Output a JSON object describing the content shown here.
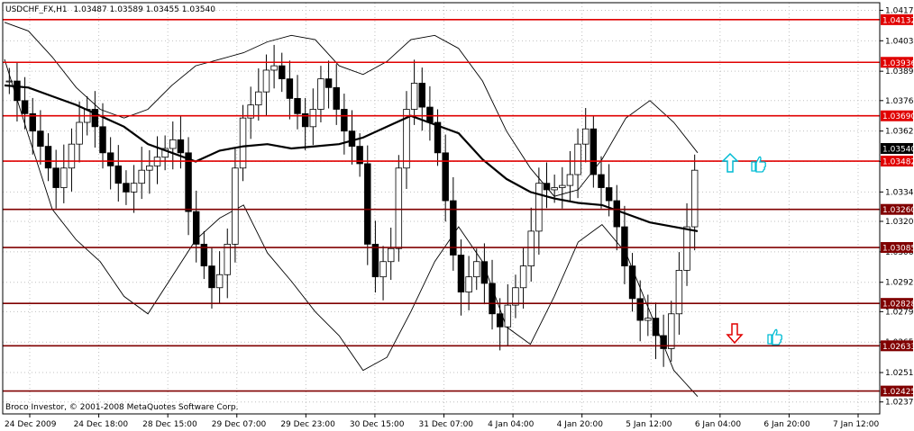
{
  "header": {
    "symbol": "USDCHF_FX,H1",
    "ohlc": "1.03487 1.03589 1.03455 1.03540"
  },
  "copyright": "Broco Investor, © 2001-2008 MetaQuotes Software Corp.",
  "colors": {
    "background": "#ffffff",
    "frame": "#000000",
    "grid": "#c0c0c0",
    "level_red": "#e00000",
    "level_dark": "#800000",
    "current_price_tag": "#000000",
    "arrow_up": "#00bcd4",
    "arrow_down": "#e00000",
    "hand_icon": "#00bcd4"
  },
  "chart_data": {
    "type": "candlestick",
    "x_ticks": [
      "24 Dec 2009",
      "24 Dec 18:00",
      "28 Dec 15:00",
      "29 Dec 07:00",
      "29 Dec 23:00",
      "30 Dec 15:00",
      "31 Dec 07:00",
      "4 Jan 04:00",
      "4 Jan 20:00",
      "5 Jan 12:00",
      "6 Jan 04:00",
      "6 Jan 20:00",
      "7 Jan 12:00"
    ],
    "y_ticks": [
      1.04175,
      1.04035,
      1.03895,
      1.0376,
      1.0362,
      1.0348,
      1.0334,
      1.03205,
      1.03065,
      1.02925,
      1.0279,
      1.0265,
      1.0251,
      1.02375
    ],
    "ylim": [
      1.0232,
      1.0421
    ],
    "grid": true,
    "current_price": 1.0354,
    "levels": [
      {
        "value": 1.04132,
        "label": "1.04132",
        "color": "red"
      },
      {
        "value": 1.03936,
        "label": "1.03936",
        "color": "red"
      },
      {
        "value": 1.0369,
        "label": "1.03690",
        "color": "red"
      },
      {
        "value": 1.03482,
        "label": "1.03482",
        "color": "red"
      },
      {
        "value": 1.0326,
        "label": "1.03260",
        "color": "dark"
      },
      {
        "value": 1.03085,
        "label": "1.03085",
        "color": "dark"
      },
      {
        "value": 1.02828,
        "label": "1.02828",
        "color": "dark"
      },
      {
        "value": 1.02633,
        "label": "1.02633",
        "color": "dark"
      },
      {
        "value": 1.02425,
        "label": "1.02425",
        "color": "dark"
      }
    ],
    "series": [
      {
        "name": "",
        "kind": "candles",
        "close": [
          1.0385,
          1.0376,
          1.037,
          1.0362,
          1.0355,
          1.0345,
          1.0336,
          1.0345,
          1.0356,
          1.0366,
          1.0372,
          1.0364,
          1.0352,
          1.0346,
          1.0338,
          1.0334,
          1.0338,
          1.0344,
          1.0346,
          1.035,
          1.0354,
          1.0358,
          1.0352,
          1.0325,
          1.031,
          1.03,
          1.029,
          1.0296,
          1.031,
          1.0345,
          1.0368,
          1.0374,
          1.038,
          1.039,
          1.0392,
          1.0386,
          1.0377,
          1.037,
          1.0364,
          1.0372,
          1.0386,
          1.0382,
          1.0372,
          1.0362,
          1.0355,
          1.0347,
          1.031,
          1.0295,
          1.0302,
          1.0308,
          1.0345,
          1.0372,
          1.0384,
          1.0373,
          1.0366,
          1.0352,
          1.033,
          1.0305,
          1.0288,
          1.0295,
          1.0302,
          1.0292,
          1.0278,
          1.0272,
          1.0282,
          1.029,
          1.03,
          1.0316,
          1.0338,
          1.0335,
          1.0336,
          1.0337,
          1.0342,
          1.0356,
          1.0363,
          1.0342,
          1.0336,
          1.033,
          1.0318,
          1.03,
          1.0285,
          1.0275,
          1.0276,
          1.0268,
          1.0262,
          1.0278,
          1.0298,
          1.0318,
          1.0344
        ]
      },
      {
        "name": "",
        "kind": "moving_average",
        "values": [
          1.0383,
          1.0382,
          1.0378,
          1.0374,
          1.0369,
          1.0364,
          1.0356,
          1.0352,
          1.0348,
          1.0353,
          1.0355,
          1.0356,
          1.0354,
          1.0355,
          1.0356,
          1.0359,
          1.0364,
          1.0369,
          1.0365,
          1.0361,
          1.0349,
          1.034,
          1.0334,
          1.0331,
          1.0329,
          1.0328,
          1.0324,
          1.032,
          1.0318,
          1.0316
        ]
      },
      {
        "name": "",
        "kind": "bollinger_upper",
        "values": [
          1.0412,
          1.0408,
          1.0396,
          1.0382,
          1.0372,
          1.0368,
          1.0372,
          1.0383,
          1.0392,
          1.0395,
          1.0398,
          1.0403,
          1.0406,
          1.0404,
          1.0392,
          1.0388,
          1.0394,
          1.0404,
          1.0406,
          1.04,
          1.0385,
          1.0362,
          1.0345,
          1.0332,
          1.0335,
          1.0349,
          1.0368,
          1.0376,
          1.0366,
          1.0352
        ]
      },
      {
        "name": "",
        "kind": "bollinger_lower",
        "values": [
          1.0395,
          1.036,
          1.0326,
          1.0312,
          1.0302,
          1.0286,
          1.0278,
          1.0295,
          1.0312,
          1.0322,
          1.0328,
          1.0306,
          1.0293,
          1.0279,
          1.0268,
          1.0252,
          1.0258,
          1.0279,
          1.0302,
          1.0318,
          1.0302,
          1.0272,
          1.0264,
          1.0286,
          1.0311,
          1.0319,
          1.0306,
          1.0279,
          1.0252,
          1.024
        ]
      }
    ]
  },
  "annotations": {
    "up_arrow": "arrow-up-icon",
    "down_arrow": "arrow-down-icon",
    "hand_up": "thumbs-up-icon",
    "hand_down": "thumbs-up-icon"
  }
}
